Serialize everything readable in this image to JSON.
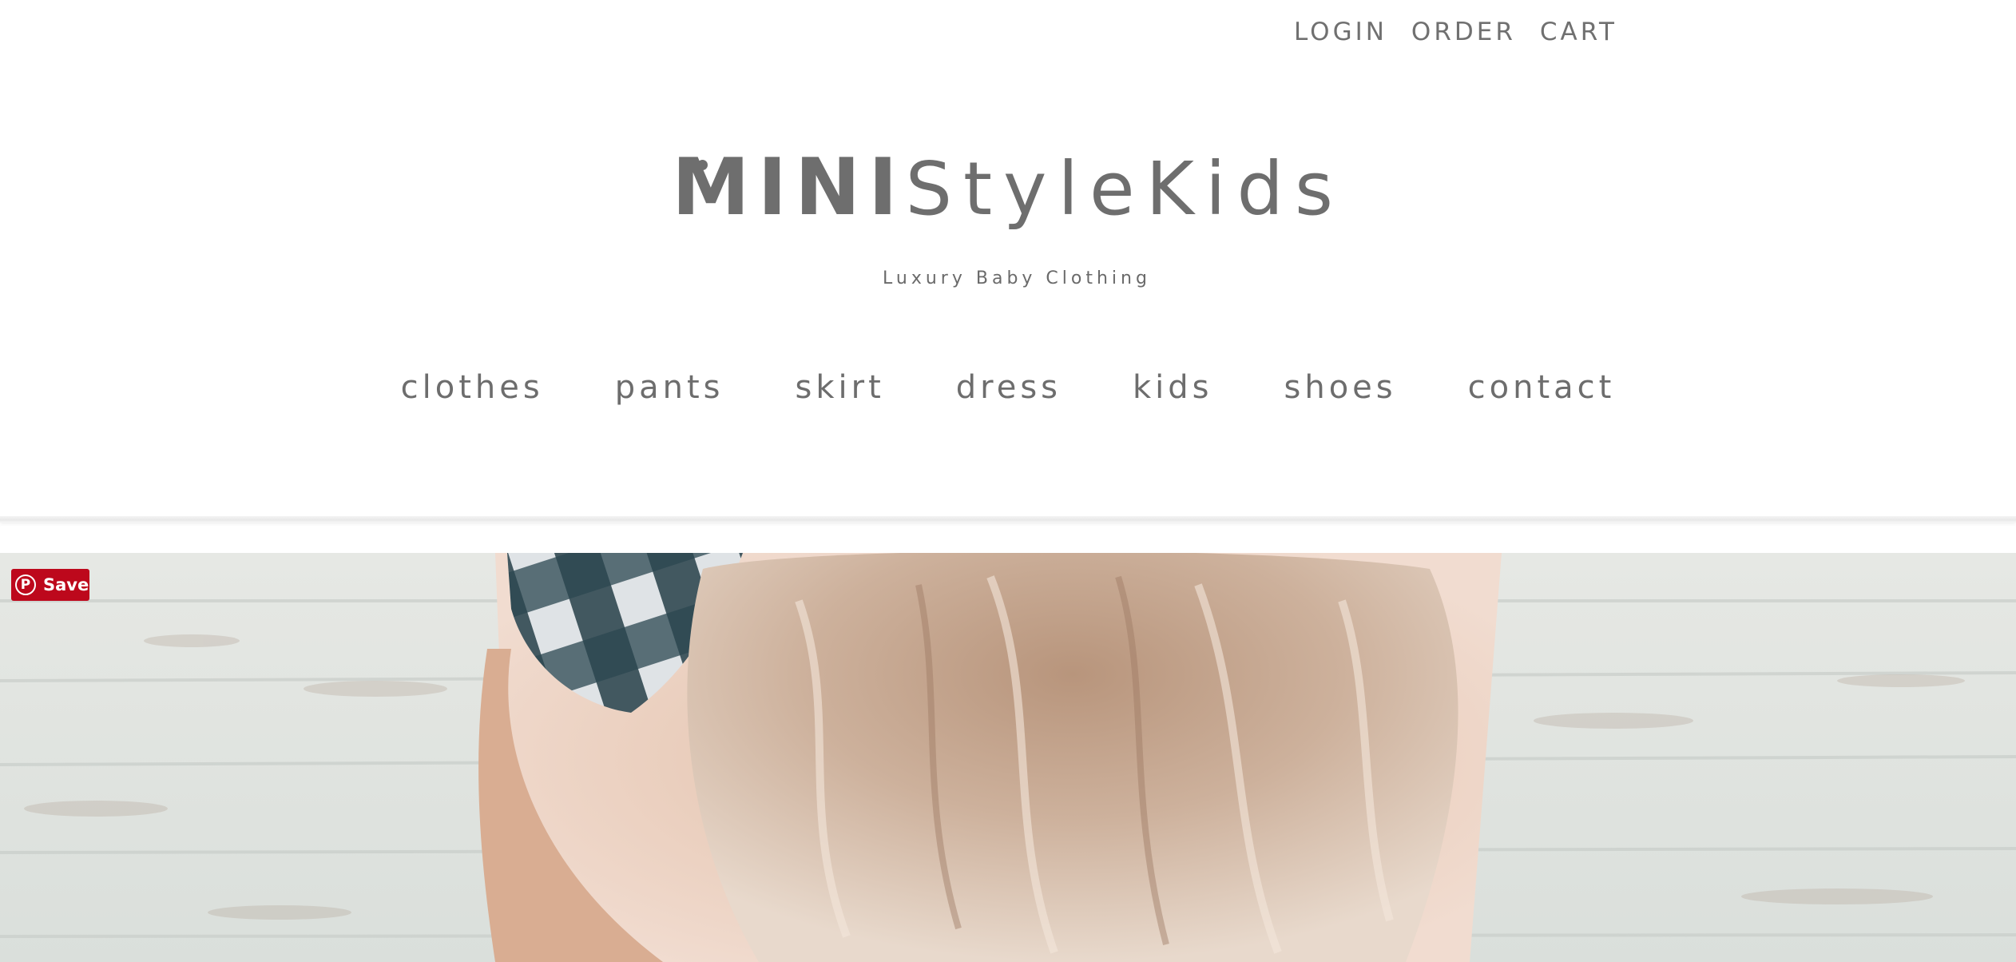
{
  "top_nav": {
    "login": "LOGIN",
    "order": "ORDER",
    "cart": "CART"
  },
  "logo": {
    "mini": "MINI",
    "style_kids": "StyleKids",
    "tagline": "Luxury Baby Clothing"
  },
  "main_nav": {
    "items": [
      "clothes",
      "pants",
      "skirt",
      "dress",
      "kids",
      "shoes",
      "contact"
    ]
  },
  "pinterest": {
    "icon": "pinterest-icon",
    "label": "Save",
    "color": "#bd081c"
  },
  "colors": {
    "text": "#6f6f6f",
    "background": "#ffffff"
  }
}
